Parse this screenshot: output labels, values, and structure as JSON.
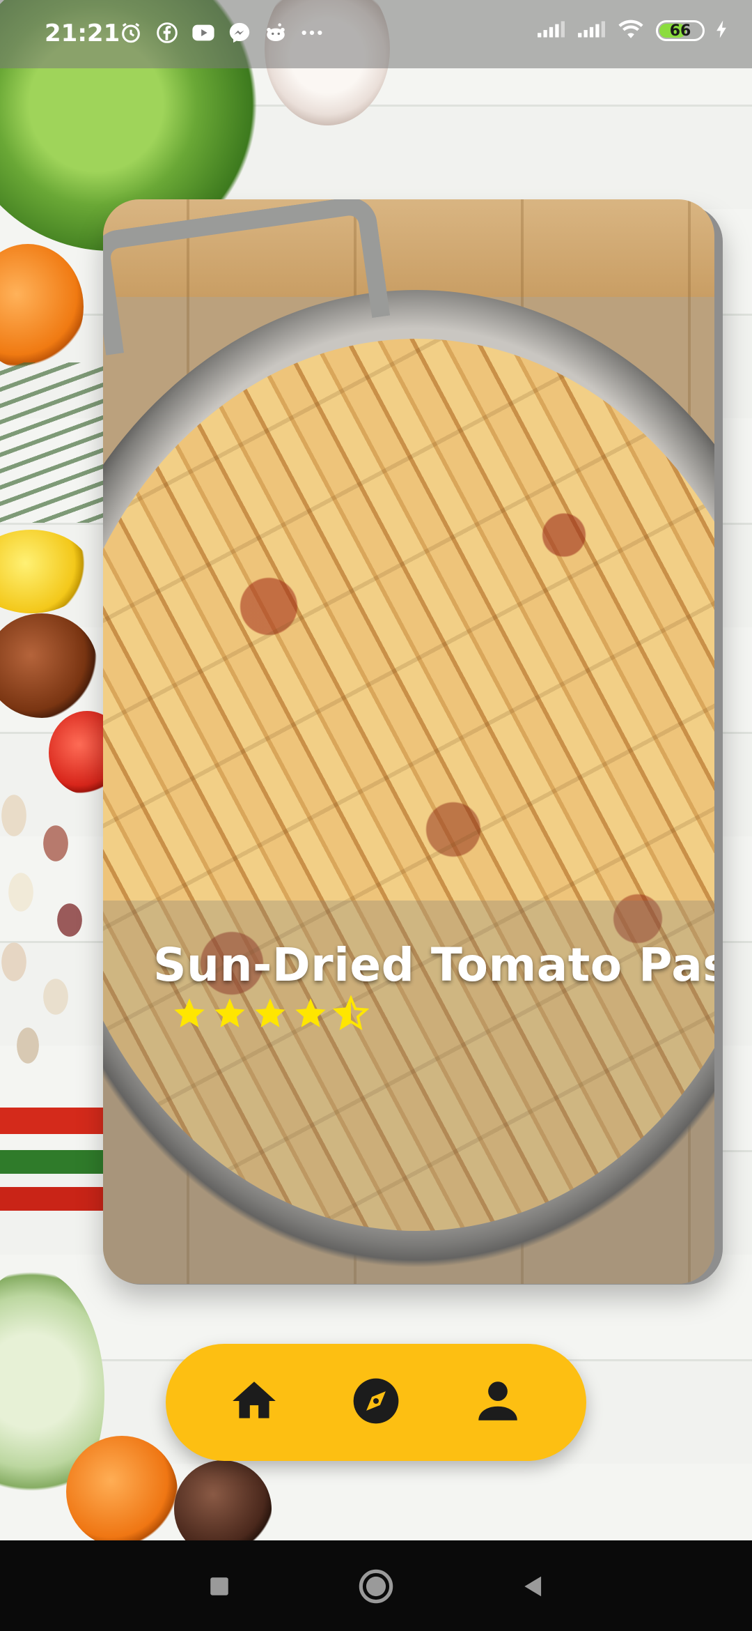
{
  "status_bar": {
    "time": "21:21",
    "left_icons": [
      "alarm-icon",
      "facebook-icon",
      "youtube-icon",
      "messenger-icon",
      "reddit-icon",
      "more-dots-icon"
    ],
    "battery_level": "66",
    "right_icons": [
      "signal-icon",
      "signal-icon",
      "wifi-icon",
      "battery-icon",
      "charging-icon"
    ]
  },
  "recipe_card": {
    "title": "Sun-Dried Tomato Pasta",
    "rating": 4.5,
    "rating_max": 5,
    "image": "creamy pasta with chicken and sun-dried tomatoes in a steel pan"
  },
  "bottom_tabs": {
    "items": [
      {
        "name": "home",
        "icon": "home-icon"
      },
      {
        "name": "explore",
        "icon": "compass-icon"
      },
      {
        "name": "profile",
        "icon": "person-icon"
      }
    ],
    "background_color": "#fdbf12",
    "icon_color": "#1c1c1c"
  },
  "system_nav": {
    "items": [
      "recent-apps-icon",
      "home-circle-icon",
      "back-icon"
    ]
  }
}
